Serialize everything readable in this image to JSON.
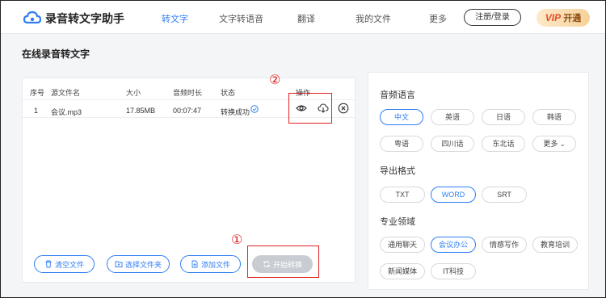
{
  "header": {
    "app_title": "录音转文字助手",
    "nav": [
      "转文字",
      "文字转语音",
      "翻译",
      "我的文件",
      "更多"
    ],
    "login_label": "注册/登录",
    "vip_prefix": "VIP",
    "vip_label": "开通"
  },
  "page_title": "在线录音转文字",
  "table": {
    "headers": [
      "序号",
      "源文件名",
      "大小",
      "音频时长",
      "状态",
      "操作"
    ],
    "rows": [
      {
        "index": "1",
        "name": "会议.mp3",
        "size": "17.85MB",
        "duration": "00:07:47",
        "status": "转换成功"
      }
    ]
  },
  "buttons": {
    "clear": "清空文件",
    "select_folder": "选择文件夹",
    "add_file": "添加文件",
    "start": "开始转换"
  },
  "annotations": {
    "one": "①",
    "two": "②"
  },
  "right": {
    "audio_language": {
      "label": "音频语言",
      "options": [
        "中文",
        "英语",
        "日语",
        "韩语",
        "粤语",
        "四川话",
        "东北话",
        "更多"
      ],
      "selected": "中文"
    },
    "export_format": {
      "label": "导出格式",
      "options": [
        "TXT",
        "WORD",
        "SRT"
      ],
      "selected": "WORD"
    },
    "domain": {
      "label": "专业领域",
      "options": [
        "通用聊天",
        "会议办公",
        "情感写作",
        "教育培训",
        "新闻媒体",
        "IT科技"
      ],
      "selected": "会议办公"
    }
  },
  "colors": {
    "accent": "#2f7ef6",
    "annotation": "#e02020",
    "success": "#2f7ef6"
  }
}
